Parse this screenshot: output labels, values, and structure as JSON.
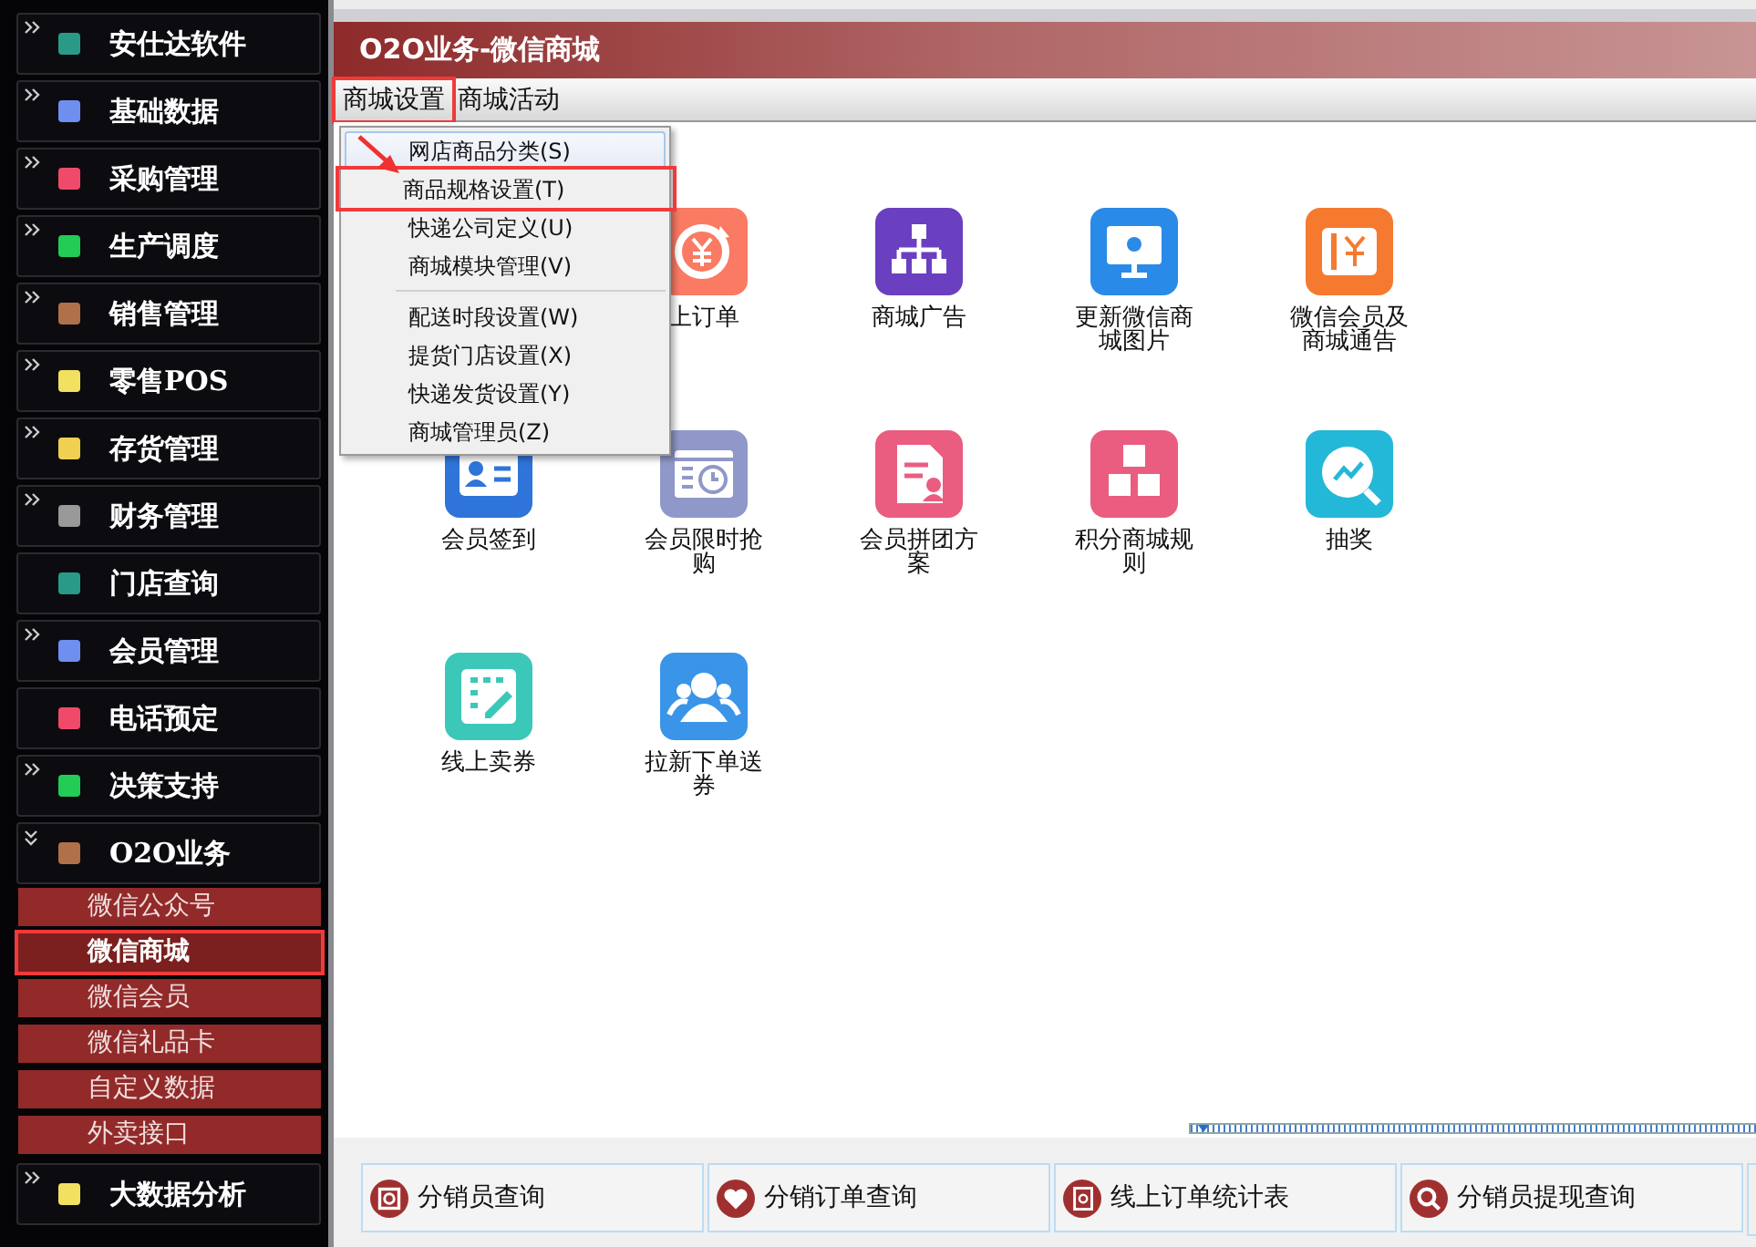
{
  "sidebar": {
    "items": [
      {
        "label": "安仕达软件",
        "expandable": true,
        "expanded": false,
        "color": "#2a9a88"
      },
      {
        "label": "基础数据",
        "expandable": true,
        "expanded": false,
        "color": "#6f8ff0"
      },
      {
        "label": "采购管理",
        "expandable": true,
        "expanded": false,
        "color": "#f04a6a"
      },
      {
        "label": "生产调度",
        "expandable": true,
        "expanded": false,
        "color": "#22cc55"
      },
      {
        "label": "销售管理",
        "expandable": true,
        "expanded": false,
        "color": "#b0704a"
      },
      {
        "label": "零售POS",
        "expandable": true,
        "expanded": false,
        "color": "#f2e060"
      },
      {
        "label": "存货管理",
        "expandable": true,
        "expanded": false,
        "color": "#f0d050"
      },
      {
        "label": "财务管理",
        "expandable": true,
        "expanded": false,
        "color": "#999999"
      },
      {
        "label": "门店查询",
        "expandable": false,
        "color": "#2a9a88"
      },
      {
        "label": "会员管理",
        "expandable": true,
        "expanded": false,
        "color": "#6f8ff0"
      },
      {
        "label": "电话预定",
        "expandable": false,
        "color": "#f04a6a"
      },
      {
        "label": "决策支持",
        "expandable": true,
        "expanded": false,
        "color": "#22cc55"
      },
      {
        "label": "O2O业务",
        "expandable": true,
        "expanded": true,
        "color": "#b0704a",
        "children": [
          {
            "label": "微信公众号",
            "selected": false,
            "highlighted": false
          },
          {
            "label": "微信商城",
            "selected": true,
            "highlighted": true
          },
          {
            "label": "微信会员",
            "selected": false,
            "highlighted": false
          },
          {
            "label": "微信礼品卡",
            "selected": false,
            "highlighted": false
          },
          {
            "label": "自定义数据",
            "selected": false,
            "highlighted": false
          },
          {
            "label": "外卖接口",
            "selected": false,
            "highlighted": false
          }
        ]
      },
      {
        "label": "大数据分析",
        "expandable": true,
        "expanded": false,
        "color": "#f2e060"
      }
    ]
  },
  "window": {
    "title": "O2O业务-微信商城"
  },
  "menu_bar": [
    {
      "label": "商城设置",
      "highlighted": true
    },
    {
      "label": "商城活动",
      "highlighted": false
    }
  ],
  "dropdown": {
    "groups": [
      [
        {
          "label": "网店商品分类(S)",
          "hovered": true,
          "highlighted": false
        },
        {
          "label": "商品规格设置(T)",
          "hovered": false,
          "highlighted": true
        },
        {
          "label": "快递公司定义(U)",
          "hovered": false,
          "highlighted": false
        },
        {
          "label": "商城模块管理(V)",
          "hovered": false,
          "highlighted": false
        }
      ],
      [
        {
          "label": "配送时段设置(W)",
          "hovered": false,
          "highlighted": false
        },
        {
          "label": "提货门店设置(X)",
          "hovered": false,
          "highlighted": false
        },
        {
          "label": "快递发货设置(Y)",
          "hovered": false,
          "highlighted": false
        },
        {
          "label": "商城管理员(Z)",
          "hovered": false,
          "highlighted": false
        }
      ]
    ]
  },
  "tiles": [
    [
      {
        "label": "上订单",
        "color": "#fa7a64"
      },
      {
        "label": "商城广告",
        "color": "#6a3fc0"
      },
      {
        "label": "更新微信商城图片",
        "color": "#2a8ae8"
      },
      {
        "label": "微信会员及商城通告",
        "color": "#f57a30"
      }
    ],
    [
      {
        "label": "会员签到",
        "color": "#2f74d8"
      },
      {
        "label": "会员限时抢购",
        "color": "#8f98c8"
      },
      {
        "label": "会员拼团方案",
        "color": "#ea5d80"
      },
      {
        "label": "积分商城规则",
        "color": "#ea5d80"
      },
      {
        "label": "抽奖",
        "color": "#24b8d8"
      }
    ],
    [
      {
        "label": "线上卖券",
        "color": "#3cc8b8"
      },
      {
        "label": "拉新下单送券",
        "color": "#3a94e8"
      }
    ]
  ],
  "shortcuts": [
    {
      "label": "分销员查询"
    },
    {
      "label": "分销订单查询"
    },
    {
      "label": "线上订单统计表"
    },
    {
      "label": "分销员提现查询"
    }
  ]
}
